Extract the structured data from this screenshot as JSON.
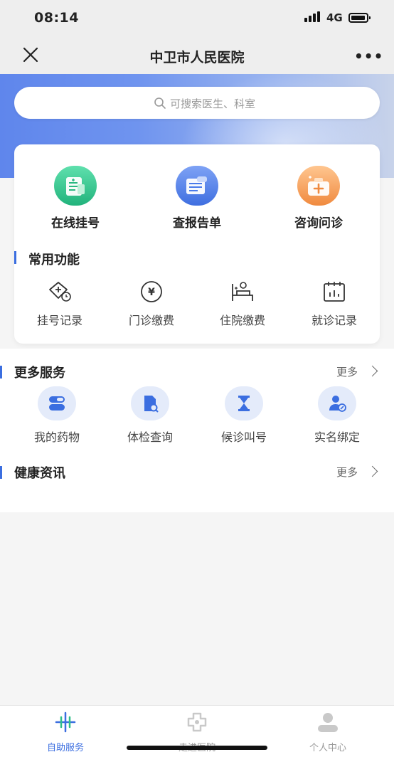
{
  "status_bar": {
    "time": "08:14",
    "network": "4G"
  },
  "nav": {
    "title": "中卫市人民医院",
    "more_label": "•••"
  },
  "search": {
    "placeholder": "可搜索医生、科室"
  },
  "main_services": [
    {
      "label": "在线挂号",
      "icon": "register-icon",
      "color": "#2fbf8a"
    },
    {
      "label": "查报告单",
      "icon": "report-icon",
      "color": "#4a7bea"
    },
    {
      "label": "咨询问诊",
      "icon": "consult-icon",
      "color": "#f39b52"
    }
  ],
  "common": {
    "title": "常用功能",
    "items": [
      {
        "label": "挂号记录",
        "icon": "register-record-icon"
      },
      {
        "label": "门诊缴费",
        "icon": "yuan-icon"
      },
      {
        "label": "住院缴费",
        "icon": "hospital-bed-icon"
      },
      {
        "label": "就诊记录",
        "icon": "calendar-icon"
      }
    ]
  },
  "more_services": {
    "title": "更多服务",
    "more": "更多",
    "items": [
      {
        "label": "我的药物",
        "icon": "pill-icon"
      },
      {
        "label": "体检查询",
        "icon": "document-search-icon"
      },
      {
        "label": "候诊叫号",
        "icon": "hourglass-icon"
      },
      {
        "label": "实名绑定",
        "icon": "user-link-icon"
      }
    ]
  },
  "health_news": {
    "title": "健康资讯",
    "more": "更多"
  },
  "tabbar": {
    "tabs": [
      {
        "label": "自助服务",
        "active": true,
        "color": "#3b6ee0"
      },
      {
        "label": "走进医院",
        "active": false,
        "color": "#999999"
      },
      {
        "label": "个人中心",
        "active": false,
        "color": "#999999"
      }
    ]
  },
  "colors": {
    "accent": "#3b6ee0",
    "bubble": "#e4ebfa"
  }
}
